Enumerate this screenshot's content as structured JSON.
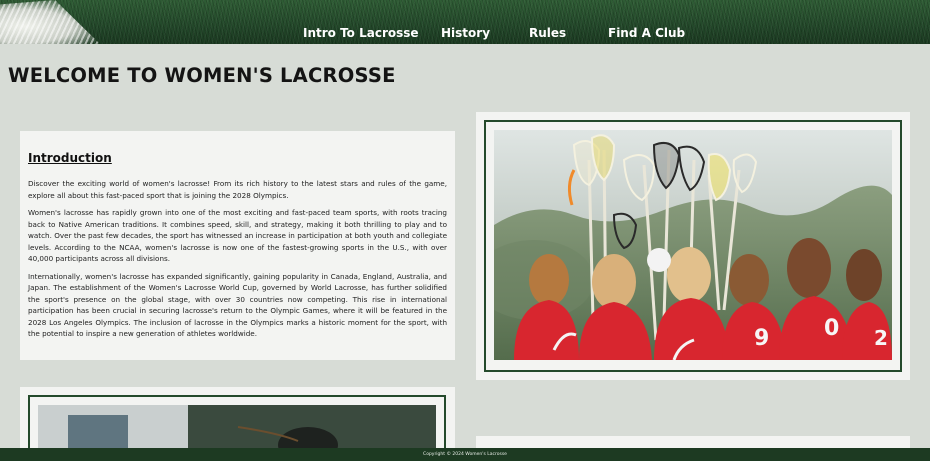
{
  "nav": {
    "items": [
      {
        "label": "Intro To Lacrosse"
      },
      {
        "label": "History"
      },
      {
        "label": "Rules"
      },
      {
        "label": "Find A Club"
      }
    ]
  },
  "page": {
    "title": "WELCOME TO WOMEN'S LACROSSE"
  },
  "intro": {
    "heading": "Introduction",
    "paragraphs": [
      "Discover the exciting world of women's lacrosse! From its rich history to the latest stars and rules of the game, explore all about this fast-paced sport that is joining the 2028 Olympics.",
      "Women's lacrosse has rapidly grown into one of the most exciting and fast-paced team sports, with roots tracing back to Native American traditions. It combines speed, skill, and strategy, making it both thrilling to play and to watch. Over the past few decades, the sport has witnessed an increase in participation at both youth and collegiate levels. According to the NCAA, women's lacrosse is now one of the fastest-growing sports in the U.S., with over 40,000 participants across all divisions.",
      "Internationally, women's lacrosse has expanded significantly, gaining popularity in Canada, England, Australia, and Japan. The establishment of the Women's Lacrosse World Cup, governed by World Lacrosse, has further solidified the sport's presence on the global stage, with over 30 countries now competing. This rise in international participation has been crucial in securing lacrosse's return to the Olympic Games, where it will be featured in the 2028 Los Angeles Olympics. The inclusion of lacrosse in the Olympics marks a historic moment for the sport, with the potential to inspire a new generation of athletes worldwide."
    ]
  },
  "footer": {
    "copyright": "Copyright © 2024 Women's Lacrosse"
  },
  "colors": {
    "header_green": "#244a2b",
    "footer_green": "#1d3a22",
    "page_bg": "#d7dcd6",
    "card_bg": "#f3f4f2",
    "jersey_red": "#d8262f"
  }
}
